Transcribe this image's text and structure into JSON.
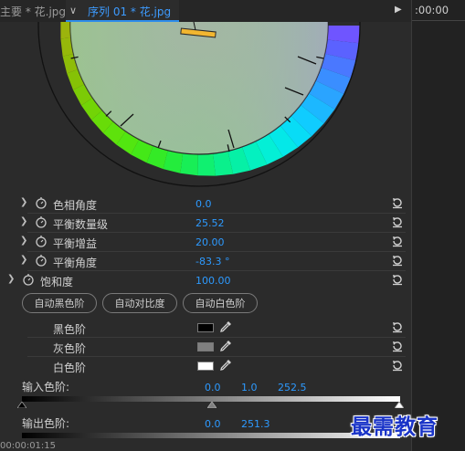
{
  "tabs": {
    "left_tab": "主要 * 花.jpg",
    "active_tab": "序列 01 * 花.jpg"
  },
  "timeline": {
    "timecode_top": ":00:00",
    "timecode_bottom": "00:00:01:15"
  },
  "properties": [
    {
      "label": "色相角度",
      "value": "0.0"
    },
    {
      "label": "平衡数量级",
      "value": "25.52"
    },
    {
      "label": "平衡增益",
      "value": "20.00"
    },
    {
      "label": "平衡角度",
      "value": "-83.3 °"
    },
    {
      "label": "饱和度",
      "value": "100.00"
    }
  ],
  "buttons": {
    "auto_black": "自动黑色阶",
    "auto_contrast": "自动对比度",
    "auto_white": "自动白色阶"
  },
  "levels": {
    "black_label": "黑色阶",
    "black_color": "#000000",
    "gray_label": "灰色阶",
    "gray_color": "#808080",
    "white_label": "白色阶",
    "white_color": "#ffffff",
    "input_label": "输入色阶:",
    "input_black": "0.0",
    "input_gamma": "1.0",
    "input_white": "252.5",
    "output_label": "输出色阶:",
    "output_black": "0.0",
    "output_white": "251.3"
  },
  "watermark": "最需教育"
}
